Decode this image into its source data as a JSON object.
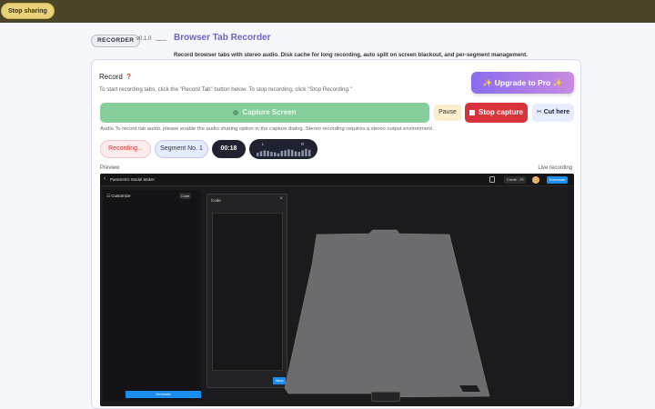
{
  "share_bar": {
    "stop_label": "Stop sharing"
  },
  "header": {
    "badge": "RECORDER",
    "version": "v0.1.0",
    "title": "Browser Tab Recorder",
    "subtitle": "Record browser tabs with stereo audio. Disk cache for long recording, auto split on screen blackout, and per-segment management."
  },
  "record": {
    "label": "Record",
    "help_icon": "?",
    "instructions": "To start recording tabs, click the \"Record Tab\" button below. To stop recording, click \"Stop Recording.\"",
    "upgrade_label": "✨ Upgrade to Pro ✨",
    "capture_label": "Capture Screen",
    "pause_label": "Pause",
    "stop_capture_label": "Stop capture",
    "cut_label": "Cut here",
    "audio_note": "Audio   To record tab audio, please enable the audio sharing option in the capture dialog. Stereo recording requires a stereo output environment.",
    "status_pill": "Recording...",
    "segment_pill": "Segment No. 1",
    "timer": "00:18",
    "meter_left_label": "L",
    "meter_right_label": "R",
    "meter_levels": [
      0.35,
      0.5,
      0.6,
      0.55,
      0.45,
      0.4,
      0.3,
      0.55,
      0.6,
      0.7,
      0.65,
      0.5,
      0.45,
      0.6,
      0.75,
      0.65
    ]
  },
  "preview": {
    "label": "Preview",
    "status": "Live recording",
    "app": {
      "title": "Parametric Model Maker",
      "credit": "Credit : 79",
      "download": "Download",
      "customize": "Customize",
      "code_button": "Code",
      "code_panel_title": "Code",
      "save": "Save",
      "generate": "Generate"
    }
  },
  "colors": {
    "accent": "#6f62c4",
    "capture_green": "#86cf9c",
    "stop_red": "#d8323b",
    "preview_bg": "#1b1b1d",
    "brand_blue": "#1a8ef0"
  }
}
